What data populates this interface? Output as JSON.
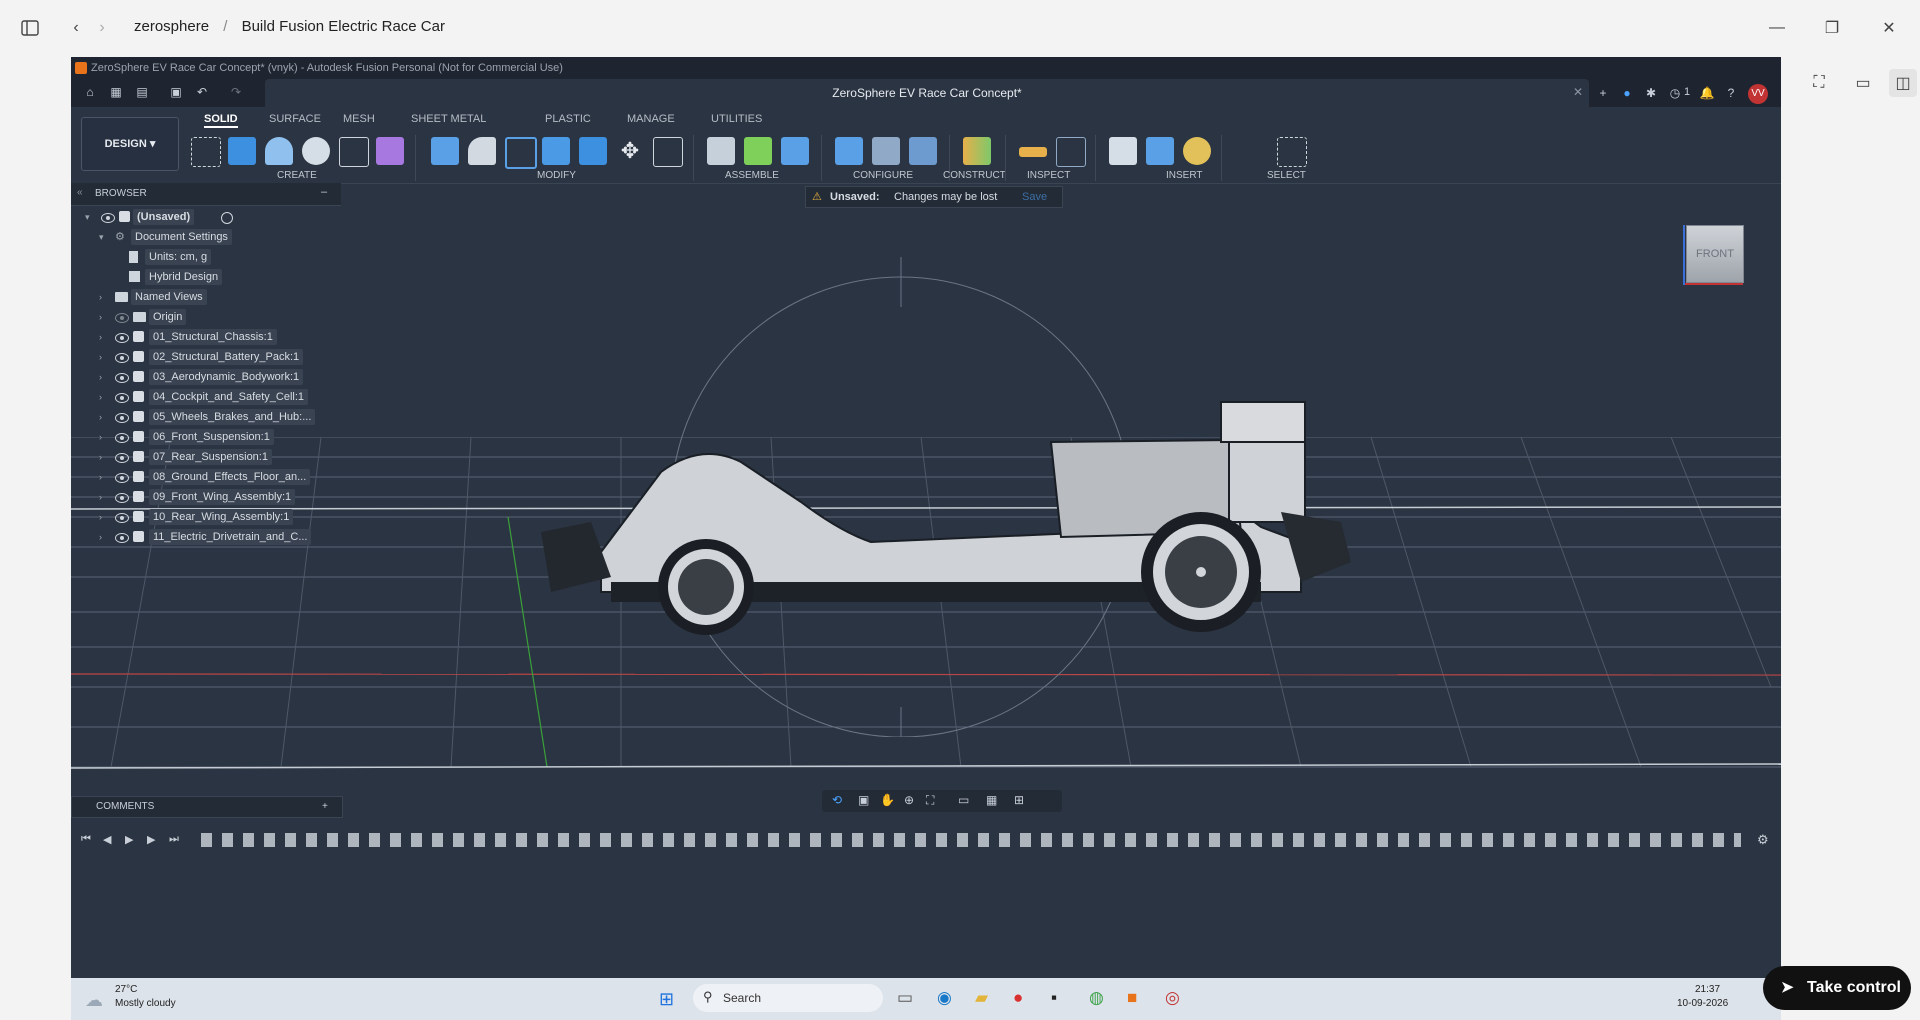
{
  "outer": {
    "breadcrumb": [
      "zerosphere",
      "/",
      "Build Fusion Electric Race Car"
    ]
  },
  "fusion": {
    "window_title": "ZeroSphere EV Race Car Concept* (vnyk) - Autodesk Fusion Personal (Not for Commercial Use)",
    "doc_tab": "ZeroSphere EV Race Car Concept*",
    "jobs_count": "1",
    "user_initials": "VV",
    "workspace": "DESIGN",
    "tabs": [
      "SOLID",
      "SURFACE",
      "MESH",
      "SHEET METAL",
      "PLASTIC",
      "MANAGE",
      "UTILITIES"
    ],
    "groups": [
      "CREATE",
      "MODIFY",
      "ASSEMBLE",
      "CONFIGURE",
      "CONSTRUCT",
      "INSPECT",
      "INSERT",
      "SELECT"
    ],
    "browser": {
      "title": "BROWSER",
      "root": "(Unsaved)",
      "doc_settings": "Document Settings",
      "units": "Units: cm, g",
      "hybrid": "Hybrid Design",
      "named_views": "Named Views",
      "origin": "Origin",
      "components": [
        "01_Structural_Chassis:1",
        "02_Structural_Battery_Pack:1",
        "03_Aerodynamic_Bodywork:1",
        "04_Cockpit_and_Safety_Cell:1",
        "05_Wheels_Brakes_and_Hub:...",
        "06_Front_Suspension:1",
        "07_Rear_Suspension:1",
        "08_Ground_Effects_Floor_an...",
        "09_Front_Wing_Assembly:1",
        "10_Rear_Wing_Assembly:1",
        "11_Electric_Drivetrain_and_C..."
      ]
    },
    "unsaved": {
      "label": "Unsaved:",
      "message": "Changes may be lost",
      "action": "Save"
    },
    "viewcube": "FRONT",
    "comments": "COMMENTS"
  },
  "taskbar": {
    "weather_temp": "27°C",
    "weather_desc": "Mostly cloudy",
    "search": "Search",
    "time": "21:37",
    "date": "10-09-2026"
  },
  "take_control": "Take control",
  "colors": {
    "fusion_bg": "#2b3442",
    "chrome_bg": "#f3f3f3",
    "accent_orange": "#e8731a",
    "avatar_red": "#c23333"
  }
}
